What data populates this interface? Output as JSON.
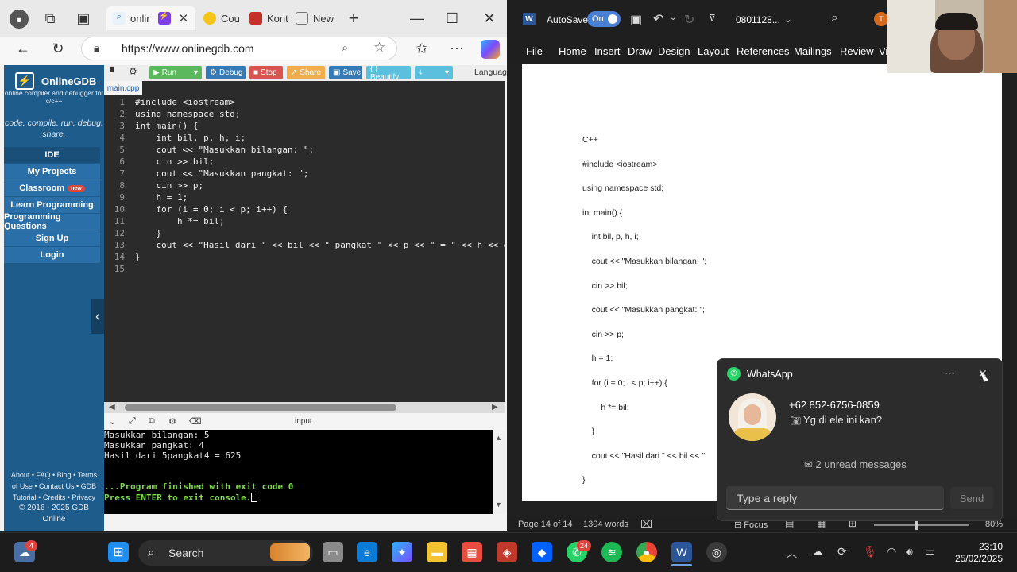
{
  "browser": {
    "tabs": [
      {
        "label": "onlir",
        "icon": "search-icon"
      },
      {
        "label": "",
        "icon": "bolt-icon"
      },
      {
        "label": "Cou",
        "icon": "course-icon"
      },
      {
        "label": "Kont",
        "icon": "youtube-icon"
      },
      {
        "label": "New",
        "icon": "newtab-icon"
      }
    ],
    "url": "https://www.onlinegdb.com"
  },
  "gdb": {
    "brand": "OnlineGDB",
    "tagline": "online compiler and debugger for c/c++",
    "motto": "code. compile. run. debug. share.",
    "nav": [
      {
        "label": "IDE"
      },
      {
        "label": "My Projects"
      },
      {
        "label": "Classroom",
        "badge": "new"
      },
      {
        "label": "Learn Programming"
      },
      {
        "label": "Programming Questions"
      },
      {
        "label": "Sign Up"
      },
      {
        "label": "Login"
      }
    ],
    "footer1": "About • FAQ • Blog • Terms",
    "footer2": "of Use • Contact Us • GDB",
    "footer3": "Tutorial • Credits • Privacy",
    "footer4": "© 2016 - 2025 GDB",
    "footer5": "Online"
  },
  "toolbar": {
    "run": "Run",
    "debug": "Debug",
    "stop": "Stop",
    "share": "Share",
    "save": "Save",
    "beautify": "{ } Beautify",
    "language": "Languag"
  },
  "file_tab": "main.cpp",
  "code_lines": [
    "#include <iostream>",
    "using namespace std;",
    "int main() {",
    "    int bil, p, h, i;",
    "    cout << \"Masukkan bilangan: \";",
    "    cin >> bil;",
    "    cout << \"Masukkan pangkat: \";",
    "    cin >> p;",
    "    h = 1;",
    "    for (i = 0; i < p; i++) {",
    "        h *= bil;",
    "    }",
    "    cout << \"Hasil dari \" << bil << \" pangkat \" << p << \" = \" << h << e",
    "}",
    ""
  ],
  "line_numbers": [
    "1",
    "2",
    "3",
    "4",
    "5",
    "6",
    "7",
    "8",
    "9",
    "10",
    "11",
    "12",
    "13",
    "14",
    "15"
  ],
  "console": {
    "label": "input",
    "lines": [
      "Masukkan bilangan: 5",
      "Masukkan pangkat: 4",
      "Hasil dari 5pangkat4 = 625"
    ],
    "finished": "...Program finished with exit code 0",
    "press": "Press ENTER to exit console."
  },
  "word": {
    "autosave": "AutoSave",
    "autosave_state": "On",
    "filename": "0801128...",
    "menu": [
      "File",
      "Home",
      "Insert",
      "Draw",
      "Design",
      "Layout",
      "References",
      "Mailings",
      "Review",
      "Vi"
    ],
    "doc_lines": [
      "C++",
      "#include <iostream>",
      "using namespace std;",
      "int main() {",
      "    int bil, p, h, i;",
      "    cout << \"Masukkan bilangan: \";",
      "    cin >> bil;",
      "    cout << \"Masukkan pangkat: \";",
      "    cin >> p;",
      "    h = 1;",
      "    for (i = 0; i < p; i++) {",
      "        h *= bil;",
      "    }",
      "    cout << \"Hasil dari \" << bil << \"",
      "}"
    ],
    "page_info": "Page 14 of 14",
    "words": "1304 words",
    "focus": "Focus",
    "zoom": "80%"
  },
  "whatsapp": {
    "app": "WhatsApp",
    "sender": "+62 852-6756-0859",
    "message": "Yg di ele ini kan?",
    "unread": "2 unread messages",
    "reply_placeholder": "Type a reply",
    "send": "Send"
  },
  "taskbar": {
    "search": "Search",
    "time": "23:10",
    "date": "25/02/2025",
    "weather_badge": "4",
    "whatsapp_badge": "24"
  }
}
